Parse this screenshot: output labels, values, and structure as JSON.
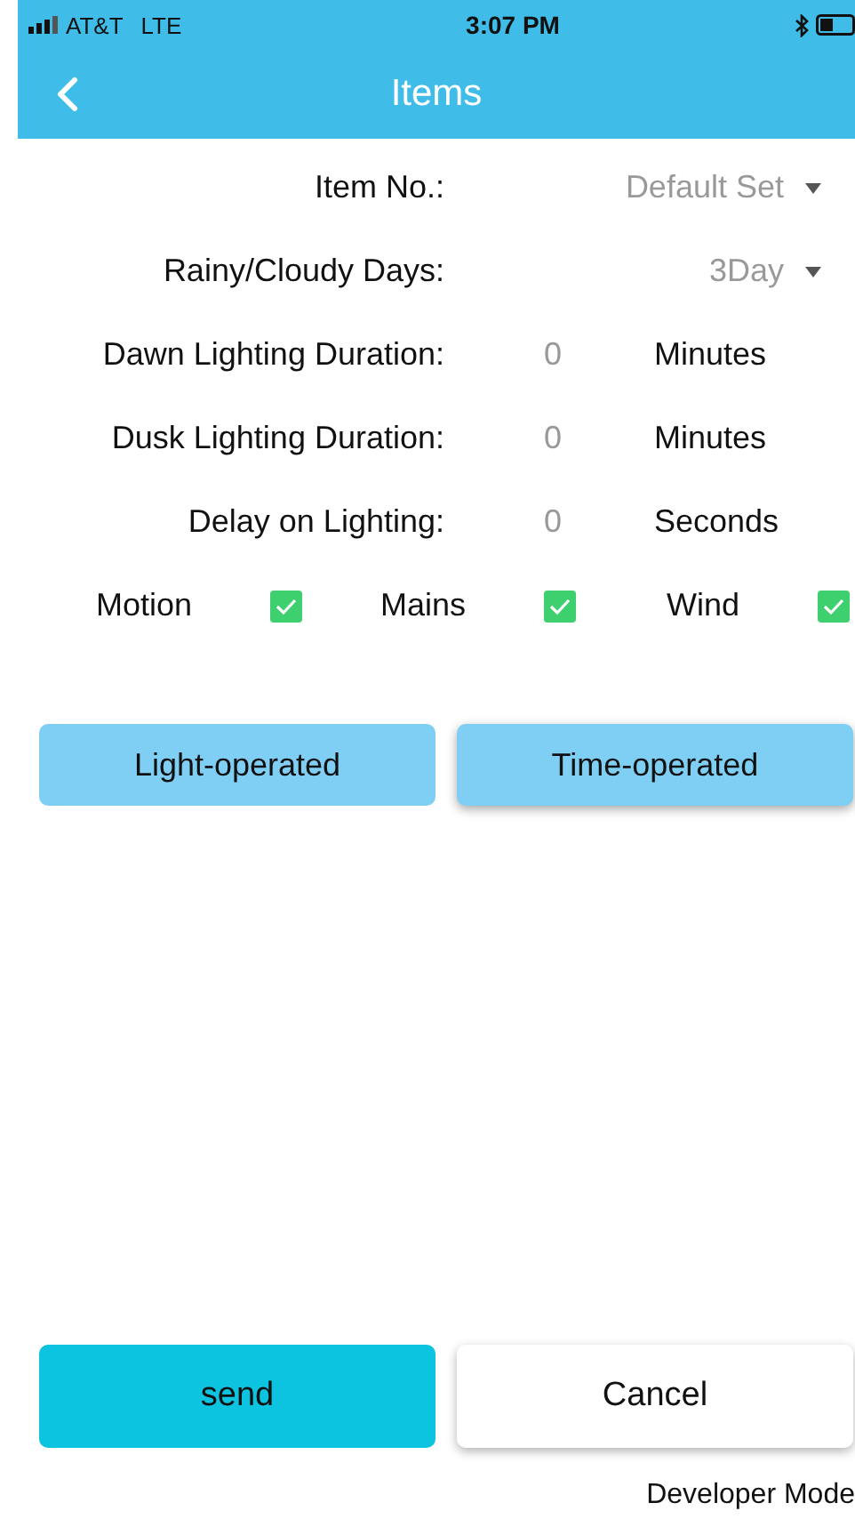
{
  "status_bar": {
    "carrier": "AT&T",
    "network": "LTE",
    "time": "3:07 PM"
  },
  "nav": {
    "title": "Items"
  },
  "settings": [
    {
      "kind": "dropdown",
      "label": "Item No.:",
      "value": "Default Set"
    },
    {
      "kind": "dropdown",
      "label": "Rainy/Cloudy Days:",
      "value": "3Day"
    },
    {
      "kind": "number",
      "label": "Dawn Lighting Duration:",
      "value": "0",
      "unit": "Minutes"
    },
    {
      "kind": "number",
      "label": "Dusk Lighting Duration:",
      "value": "0",
      "unit": "Minutes"
    },
    {
      "kind": "number",
      "label": "Delay on Lighting:",
      "value": "0",
      "unit": "Seconds"
    }
  ],
  "checks": [
    {
      "label": "Motion",
      "checked": true
    },
    {
      "label": "Mains",
      "checked": true
    },
    {
      "label": "Wind",
      "checked": true
    }
  ],
  "modes": [
    {
      "label": "Light-operated",
      "selected": false
    },
    {
      "label": "Time-operated",
      "selected": true
    }
  ],
  "actions": [
    {
      "kind": "primary",
      "label": "send"
    },
    {
      "kind": "secondary",
      "label": "Cancel"
    }
  ],
  "footer": "Developer Mode"
}
